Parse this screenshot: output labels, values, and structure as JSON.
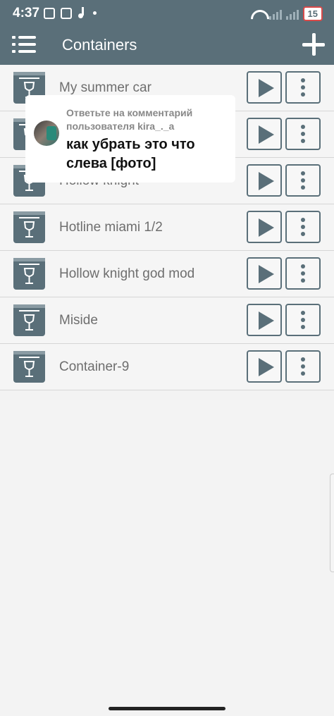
{
  "status_bar": {
    "time": "4:37",
    "battery": "15"
  },
  "app_bar": {
    "title": "Containers",
    "menu_icon": "hamburger-menu-icon",
    "add_icon": "plus-icon"
  },
  "containers": [
    {
      "name": "My summer car"
    },
    {
      "name": ""
    },
    {
      "name": "Hollow knight"
    },
    {
      "name": "Hotline miami 1/2"
    },
    {
      "name": "Hollow knight god mod"
    },
    {
      "name": "Miside"
    },
    {
      "name": "Container-9"
    }
  ],
  "comment_overlay": {
    "reply_text": "Ответьте на комментарий пользователя kira_._a",
    "comment_text": "как убрать это что слева [фото]"
  },
  "colors": {
    "primary": "#5a6f79",
    "background": "#f5f5f5",
    "text": "#6e6e6e"
  }
}
